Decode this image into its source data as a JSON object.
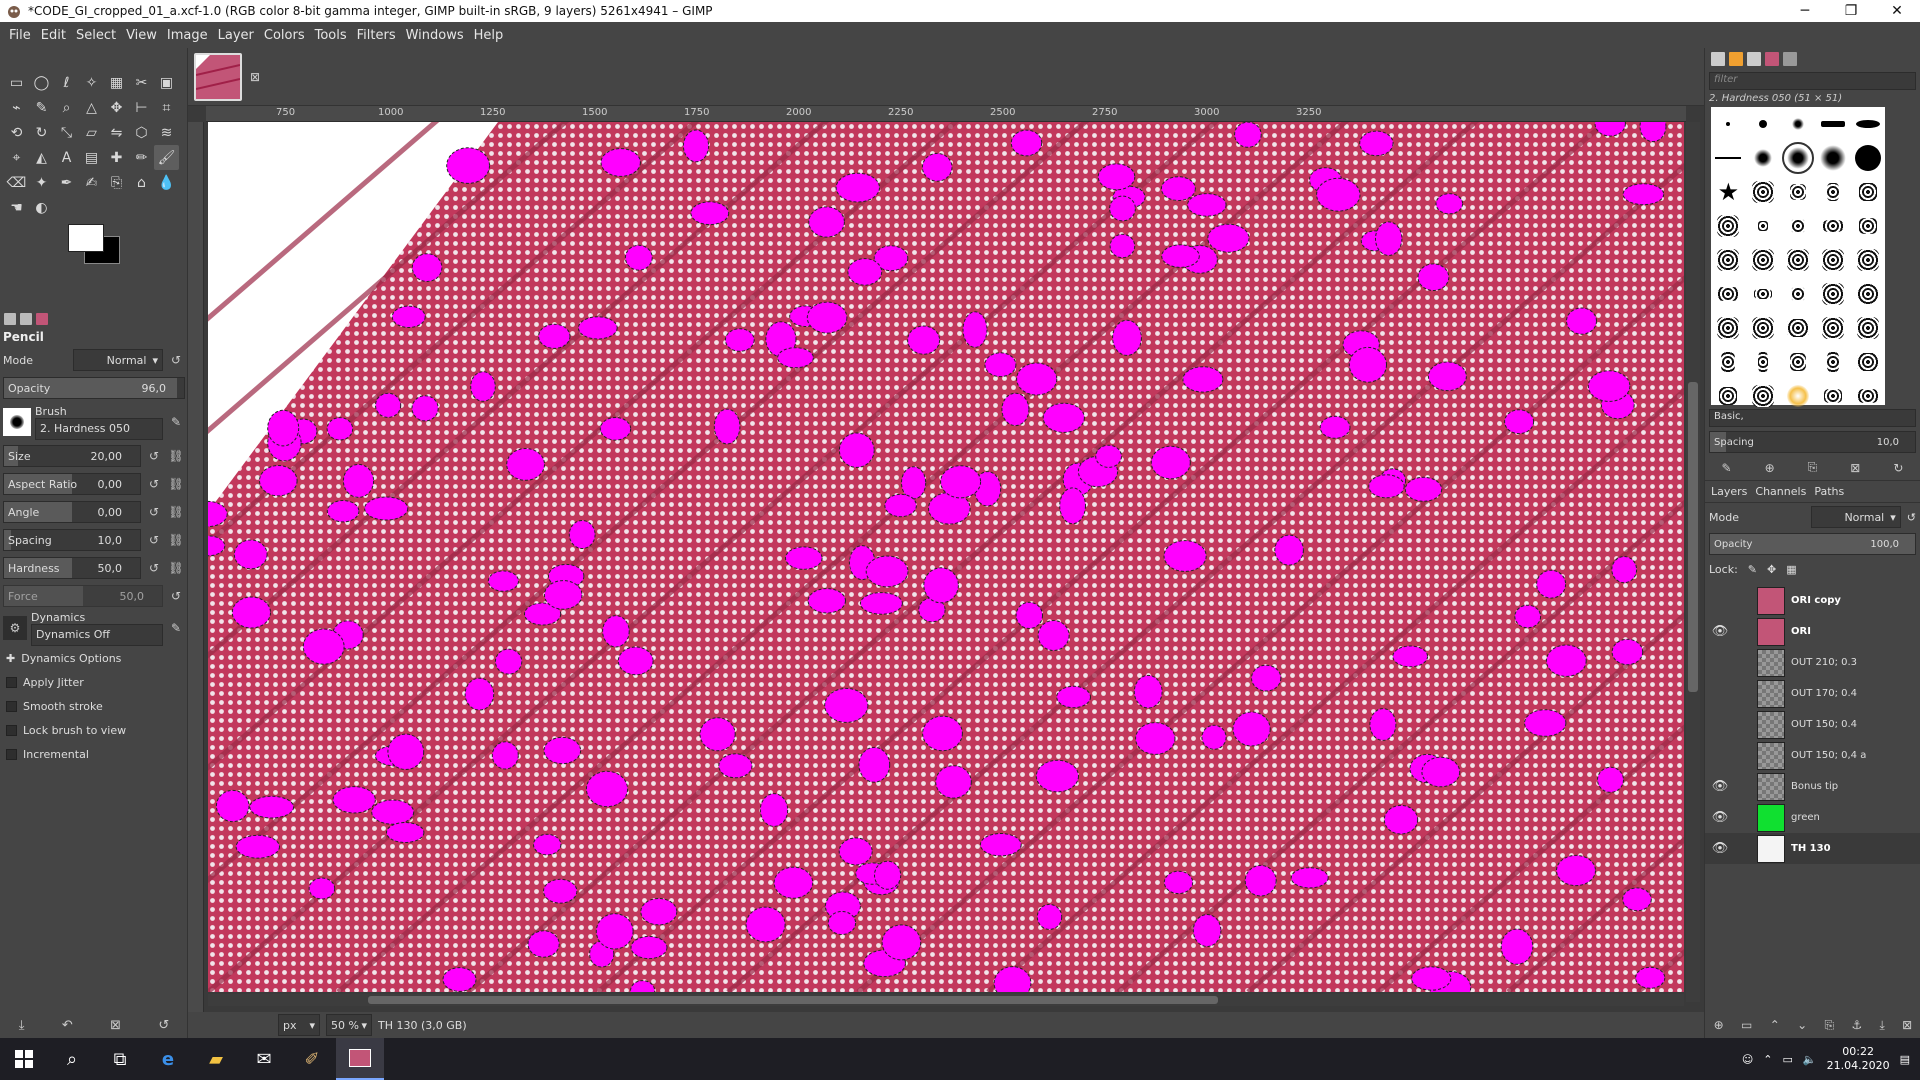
{
  "window": {
    "title": "*CODE_GI_cropped_01_a.xcf-1.0 (RGB color 8-bit gamma integer, GIMP built-in sRGB, 9 layers) 5261x4941 – GIMP",
    "minimize": "─",
    "maximize": "❐",
    "close": "✕"
  },
  "menu": [
    "File",
    "Edit",
    "Select",
    "View",
    "Image",
    "Layer",
    "Colors",
    "Tools",
    "Filters",
    "Windows",
    "Help"
  ],
  "tool_options": {
    "tool_name": "Pencil",
    "mode_label": "Mode",
    "mode_value": "Normal",
    "opacity_label": "Opacity",
    "opacity_value": "96,0",
    "opacity_fraction": 0.96,
    "brush_label": "Brush",
    "brush_value": "2. Hardness 050",
    "size_label": "Size",
    "size_value": "20,00",
    "aspect_label": "Aspect Ratio",
    "aspect_value": "0,00",
    "angle_label": "Angle",
    "angle_value": "0,00",
    "spacing_label": "Spacing",
    "spacing_value": "10,0",
    "hardness_label": "Hardness",
    "hardness_value": "50,0",
    "force_label": "Force",
    "force_value": "50,0",
    "dynamics_label": "Dynamics",
    "dynamics_value": "Dynamics Off",
    "dynamics_options": "Dynamics Options",
    "apply_jitter": "Apply Jitter",
    "smooth_stroke": "Smooth stroke",
    "lock_brush": "Lock brush to view",
    "incremental": "Incremental"
  },
  "ruler": [
    "750",
    "1000",
    "1250",
    "1500",
    "1750",
    "2000",
    "2250",
    "2500",
    "2750",
    "3000",
    "3250"
  ],
  "status": {
    "unit": "px",
    "zoom": "50 %",
    "info": "TH 130 (3,0 GB)"
  },
  "brushes": {
    "filter_placeholder": "filter",
    "current_brush": "2. Hardness 050 (51 × 51)",
    "tag": "Basic,",
    "spacing_label": "Spacing",
    "spacing_value": "10,0"
  },
  "layers_panel": {
    "tab_layers": "Layers",
    "tab_channels": "Channels",
    "tab_paths": "Paths",
    "mode_label": "Mode",
    "mode_value": "Normal",
    "opacity_label": "Opacity",
    "opacity_value": "100,0",
    "lock_label": "Lock:",
    "items": [
      {
        "name": "ORI copy",
        "visible": false,
        "thumb": "ori",
        "bold": true
      },
      {
        "name": "ORI",
        "visible": true,
        "thumb": "ori",
        "bold": true
      },
      {
        "name": "OUT 210; 0.3",
        "visible": false,
        "thumb": "trans",
        "bold": false
      },
      {
        "name": "OUT 170; 0.4",
        "visible": false,
        "thumb": "trans",
        "bold": false
      },
      {
        "name": "OUT 150; 0.4",
        "visible": false,
        "thumb": "trans",
        "bold": false
      },
      {
        "name": "OUT 150; 0,4 a",
        "visible": false,
        "thumb": "trans",
        "bold": false
      },
      {
        "name": "Bonus tip",
        "visible": true,
        "thumb": "trans",
        "bold": false
      },
      {
        "name": "green",
        "visible": true,
        "thumb": "green",
        "bold": false
      },
      {
        "name": "TH 130",
        "visible": true,
        "thumb": "white",
        "bold": true
      }
    ]
  },
  "taskbar": {
    "time": "00:22",
    "date": "21.04.2020"
  },
  "colors": {
    "accent_magenta": "#ff00ff",
    "tissue": "#c0385a"
  }
}
